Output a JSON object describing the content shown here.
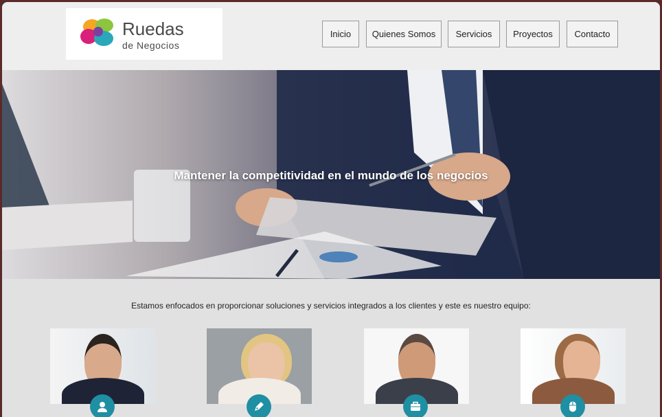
{
  "logo": {
    "title": "Ruedas",
    "subtitle": "de Negocios"
  },
  "nav": [
    {
      "label": "Inicio"
    },
    {
      "label": "Quienes Somos"
    },
    {
      "label": "Servicios"
    },
    {
      "label": "Proyectos"
    },
    {
      "label": "Contacto"
    }
  ],
  "hero": {
    "title": "Mantener la competitividad en el mundo de los negocios"
  },
  "intro": {
    "text": "Estamos enfocados en proporcionar soluciones y servicios integrados a los clientes y este es nuestro equipo:"
  },
  "team": [
    {
      "photo": "man-smiling-suit-photo",
      "icon": "user-icon"
    },
    {
      "photo": "woman-blonde-smiling-photo",
      "icon": "pen-icon"
    },
    {
      "photo": "man-grey-hair-suit-photo",
      "icon": "briefcase-icon"
    },
    {
      "photo": "woman-brown-hair-photo",
      "icon": "mouse-icon"
    }
  ],
  "colors": {
    "accent": "#1f8fa3",
    "header_bg": "#efeeee",
    "page_bg": "#e2e1e1"
  }
}
